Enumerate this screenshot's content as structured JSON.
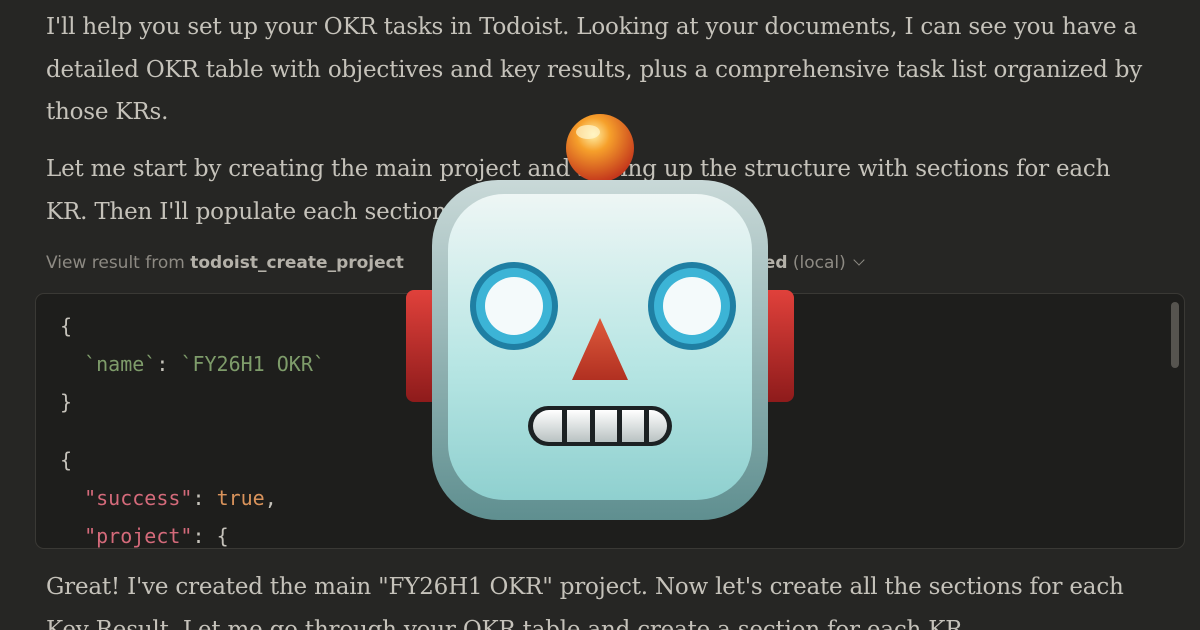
{
  "messages": {
    "intro": "I'll help you set up your OKR tasks in Todoist. Looking at your documents, I can see you have a detailed OKR table with objectives and key results, plus a comprehensive task list organized by those KRs.",
    "plan": "Let me start by creating the main project and setting up the structure with sections for each KR. Then I'll populate each section with the relevant tasks.",
    "followup": "Great! I've created the main \"FY26H1 OKR\" project. Now let's create all the sections for each Key Result. Let me go through your OKR table and create a section for each KR."
  },
  "tool_call": {
    "prefix": "View result from ",
    "tool_name": "todoist_create_project",
    "from_label": " from ",
    "server_name": "todoist-mcp-extended",
    "location": "(local)",
    "suffix_bold": "ended",
    "suffix_rest": " (local)"
  },
  "code": {
    "request": {
      "open": "{",
      "key": "`name`",
      "colon": ": ",
      "value": "`FY26H1 OKR`",
      "close": "}"
    },
    "response": {
      "open": "{",
      "key1": "\"success\"",
      "val1": "true",
      "key2": "\"project\"",
      "val2": "{"
    }
  },
  "overlay": {
    "icon": "robot-face-icon",
    "colors": {
      "face": "#b8e6e4",
      "eyes": "#2a9fc0",
      "nose": "#c8432f",
      "ears": "#c42b2b",
      "antenna": "#f08a1c"
    }
  }
}
